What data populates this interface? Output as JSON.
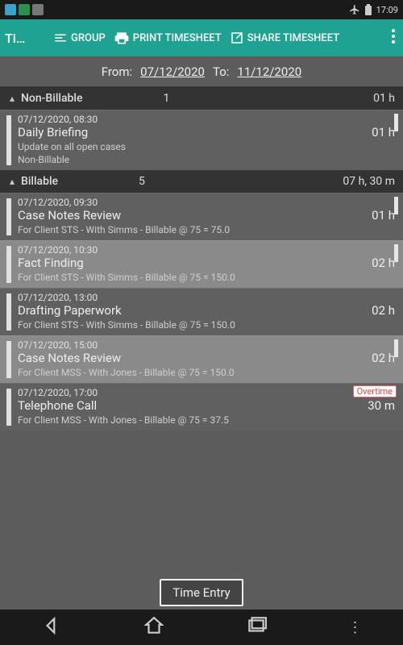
{
  "statusbar": {
    "time": "17:09"
  },
  "appbar": {
    "title": "Timesheet",
    "group": "GROUP",
    "print": "PRINT TIMESHEET",
    "share": "SHARE TIMESHEET"
  },
  "daterange": {
    "from_label": "From:",
    "from": "07/12/2020",
    "to_label": "To:",
    "to": "11/12/2020"
  },
  "groups": [
    {
      "name": "Non-Billable",
      "count": "1",
      "duration": "01 h",
      "entries": [
        {
          "timestamp": "07/12/2020, 08:30",
          "title": "Daily Briefing",
          "duration": "01 h",
          "detail1": "Update on all open cases",
          "detail2": "Non-Billable",
          "shade": 0,
          "rstripe": true
        }
      ]
    },
    {
      "name": "Billable",
      "count": "5",
      "duration": "07 h, 30 m",
      "entries": [
        {
          "timestamp": "07/12/2020, 09:30",
          "title": "Case Notes Review",
          "duration": "01 h",
          "detail1": "For Client STS - With Simms - Billable @ 75 = 75.0",
          "shade": 0,
          "rstripe": true
        },
        {
          "timestamp": "07/12/2020, 10:30",
          "title": "Fact Finding",
          "duration": "02 h",
          "detail1": "For Client STS - With Simms - Billable @ 75 = 150.0",
          "shade": 1,
          "rstripe": true
        },
        {
          "timestamp": "07/12/2020, 13:00",
          "title": "Drafting Paperwork",
          "duration": "02 h",
          "detail1": "For Client STS - With Simms - Billable @ 75 = 150.0",
          "shade": 0
        },
        {
          "timestamp": "07/12/2020, 15:00",
          "title": "Case Notes Review",
          "duration": "02 h",
          "detail1": "For Client MSS - With Jones - Billable @ 75 = 150.0",
          "shade": 1,
          "rstripe": true
        },
        {
          "timestamp": "07/12/2020, 17:00",
          "title": "Telephone Call",
          "duration": "30 m",
          "detail1": "For Client MSS - With Jones - Billable @ 75 = 37.5",
          "shade": 0,
          "badge": "Overtime"
        }
      ]
    }
  ],
  "bottom_button": "Time Entry"
}
